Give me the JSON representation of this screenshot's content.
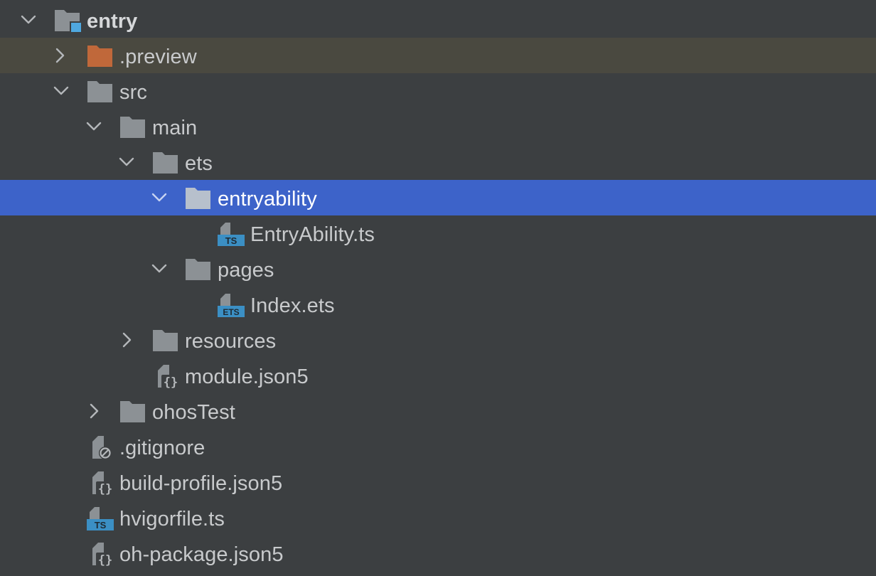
{
  "tree": {
    "root": {
      "label": "entry"
    },
    "preview": {
      "label": ".preview"
    },
    "src": {
      "label": "src"
    },
    "main": {
      "label": "main"
    },
    "ets": {
      "label": "ets"
    },
    "entryability": {
      "label": "entryability"
    },
    "entry_ability_ts": {
      "label": "EntryAbility.ts",
      "badge": "TS"
    },
    "pages": {
      "label": "pages"
    },
    "index_ets": {
      "label": "Index.ets",
      "badge": "ETS"
    },
    "resources": {
      "label": "resources"
    },
    "module_json5": {
      "label": "module.json5"
    },
    "ohos_test": {
      "label": "ohosTest"
    },
    "gitignore": {
      "label": ".gitignore"
    },
    "build_profile": {
      "label": "build-profile.json5"
    },
    "hvigorfile": {
      "label": "hvigorfile.ts",
      "badge": "TS"
    },
    "oh_package": {
      "label": "oh-package.json5"
    }
  },
  "colors": {
    "background": "#3c3f41",
    "selection": "#3d63c9",
    "highlight": "#4a4940",
    "folder": "#8c9195",
    "excluded_folder": "#c0683a",
    "module_marker": "#4fa8e0",
    "ts_badge": "#3b8fc4",
    "text": "#c8cacc"
  },
  "icons": {
    "root": "module-folder-icon",
    "preview": "excluded-folder-icon",
    "folder": "folder-icon",
    "ts_file": "typescript-file-icon",
    "ets_file": "ets-file-icon",
    "json5_file": "json5-file-icon",
    "ignore_file": "ignore-file-icon"
  }
}
